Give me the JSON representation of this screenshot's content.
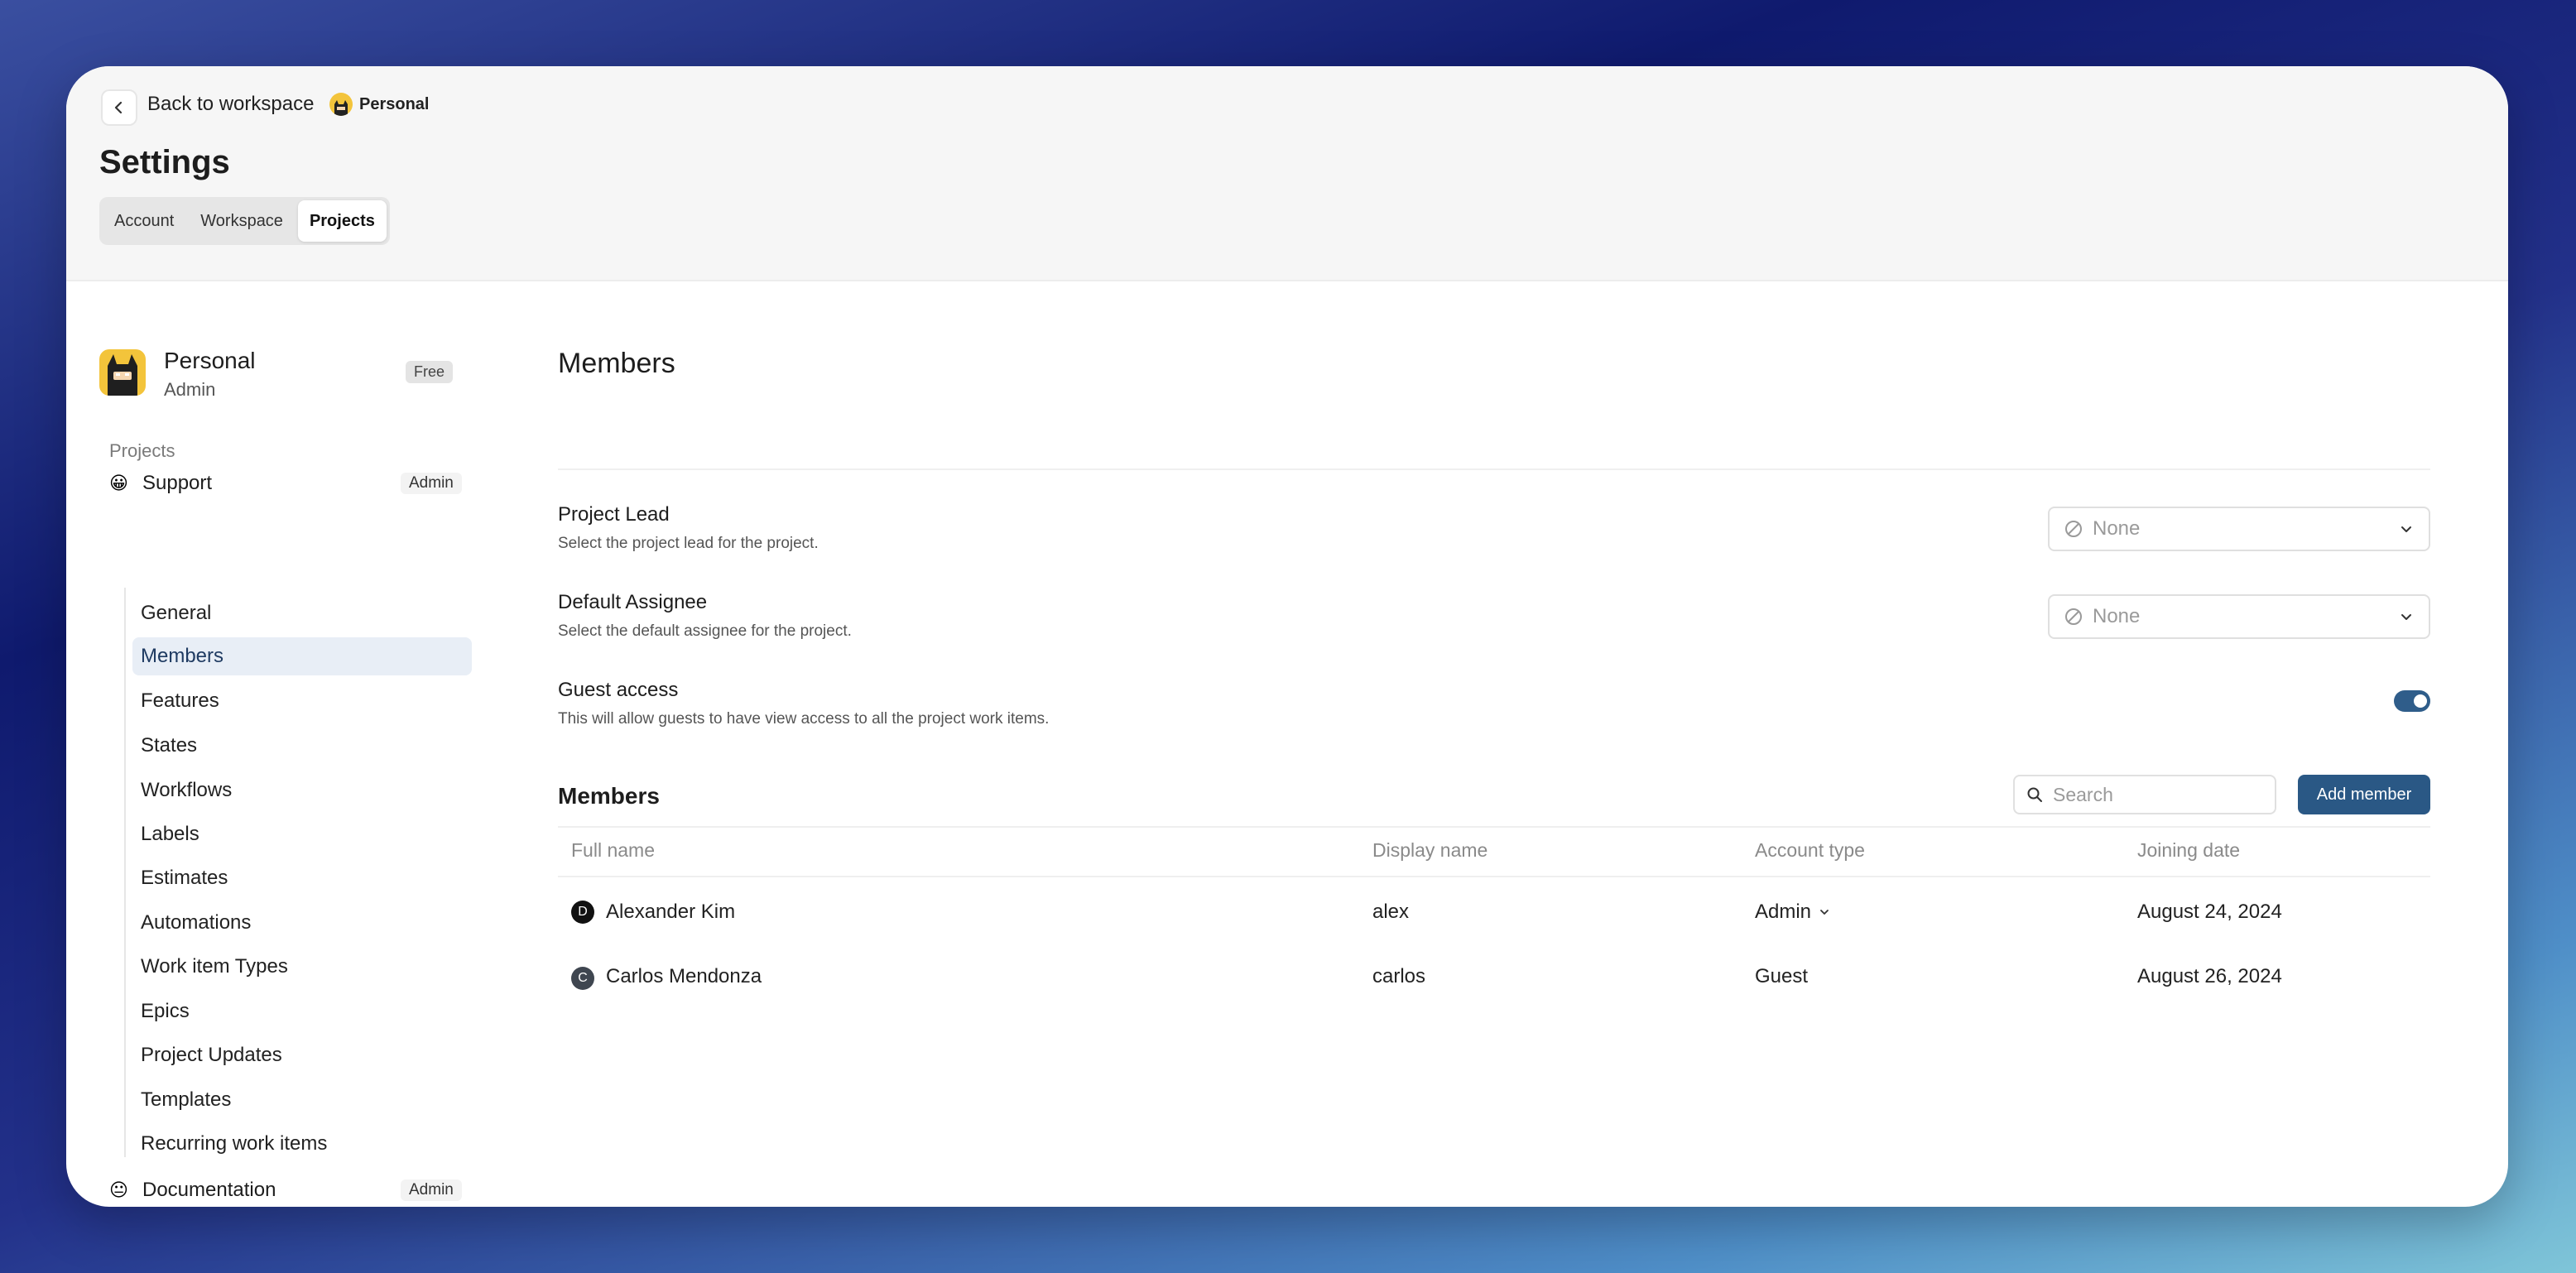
{
  "header": {
    "back_label": "Back to workspace",
    "workspace_badge": "Personal",
    "title": "Settings",
    "tabs": [
      {
        "label": "Account"
      },
      {
        "label": "Workspace"
      },
      {
        "label": "Projects"
      }
    ]
  },
  "sidebar": {
    "workspace_name": "Personal",
    "workspace_role": "Admin",
    "plan_badge": "Free",
    "projects_label": "Projects",
    "projects": [
      {
        "emoji": "😀",
        "name": "Support",
        "role": "Admin"
      },
      {
        "emoji": "😐",
        "name": "Documentation",
        "role": "Admin"
      }
    ],
    "items": [
      {
        "label": "General"
      },
      {
        "label": "Members"
      },
      {
        "label": "Features"
      },
      {
        "label": "States"
      },
      {
        "label": "Workflows"
      },
      {
        "label": "Labels"
      },
      {
        "label": "Estimates"
      },
      {
        "label": "Automations"
      },
      {
        "label": "Work item Types"
      },
      {
        "label": "Epics"
      },
      {
        "label": "Project Updates"
      },
      {
        "label": "Templates"
      },
      {
        "label": "Recurring work items"
      }
    ]
  },
  "main": {
    "title": "Members",
    "project_lead": {
      "title": "Project Lead",
      "description": "Select the project lead for the project.",
      "value": "None"
    },
    "default_assignee": {
      "title": "Default Assignee",
      "description": "Select the default assignee for the project.",
      "value": "None"
    },
    "guest_access": {
      "title": "Guest access",
      "description": "This will allow guests to have view access to all the project work items.",
      "enabled": true
    },
    "members_section": {
      "title": "Members",
      "search_placeholder": "Search",
      "add_button": "Add member",
      "columns": [
        "Full name",
        "Display name",
        "Account type",
        "Joining date"
      ],
      "rows": [
        {
          "initial": "D",
          "full_name": "Alexander Kim",
          "display_name": "alex",
          "account_type": "Admin",
          "joining_date": "August 24, 2024"
        },
        {
          "initial": "C",
          "full_name": "Carlos Mendonza",
          "display_name": "carlos",
          "account_type": "Guest",
          "joining_date": "August 26, 2024"
        }
      ]
    }
  },
  "colors": {
    "accent": "#2a5885",
    "toggle_on": "#2f5d8a",
    "active_nav_bg": "#e8eef6"
  }
}
